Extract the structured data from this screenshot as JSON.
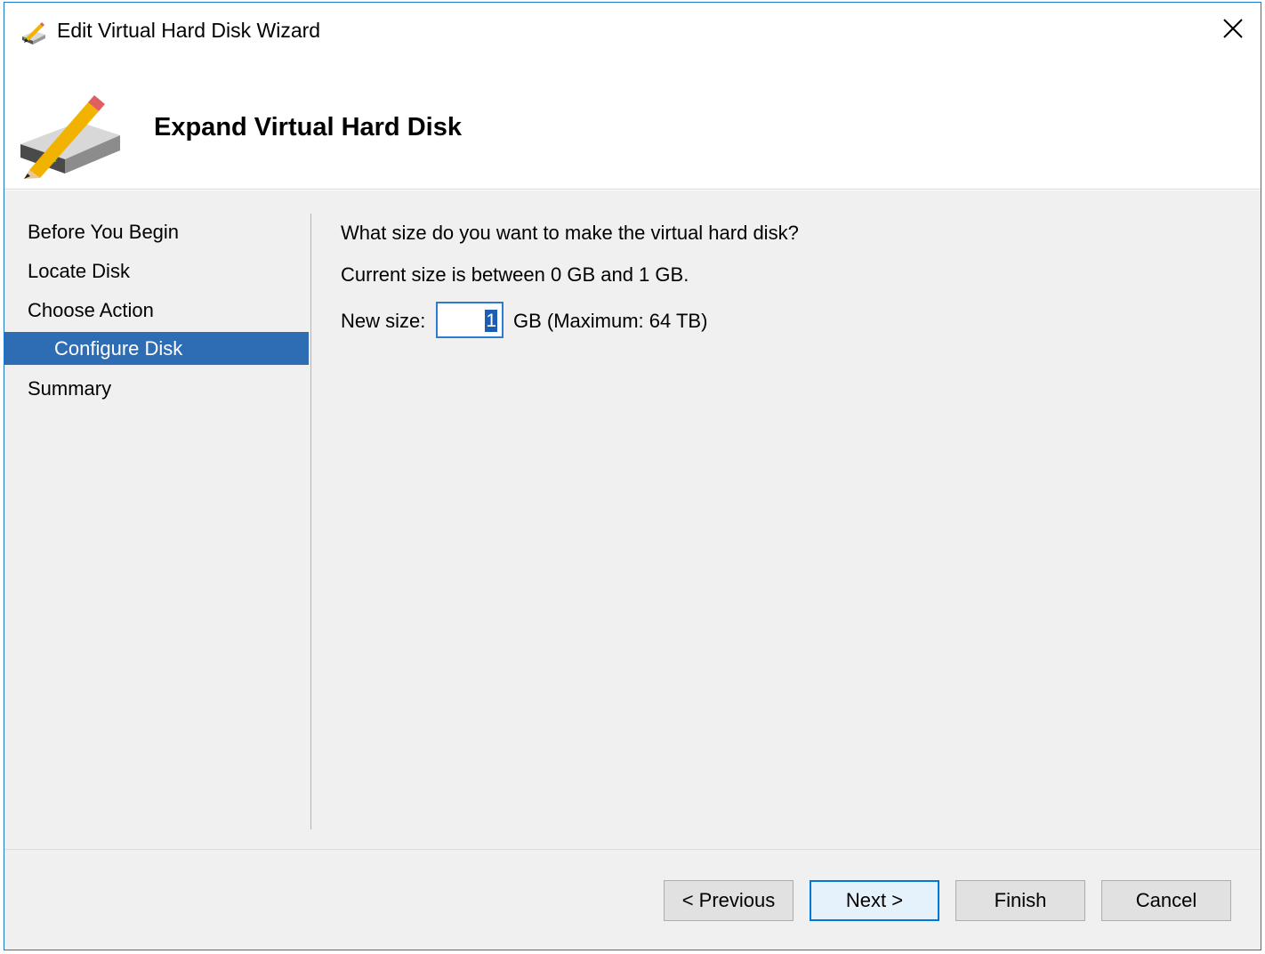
{
  "window": {
    "title": "Edit Virtual Hard Disk Wizard",
    "icon": "pencil-disk-icon",
    "close_icon": "close-icon"
  },
  "header": {
    "title": "Expand Virtual Hard Disk",
    "icon": "pencil-disk-icon"
  },
  "nav": {
    "items": [
      {
        "label": "Before You Begin",
        "active": false
      },
      {
        "label": "Locate Disk",
        "active": false
      },
      {
        "label": "Choose Action",
        "active": false
      },
      {
        "label": "Configure Disk",
        "active": true
      },
      {
        "label": "Summary",
        "active": false
      }
    ]
  },
  "content": {
    "question": "What size do you want to make the virtual hard disk?",
    "current_range": "Current size is between 0 GB and 1 GB.",
    "new_size_label": "New size:",
    "new_size_value": "1",
    "unit_text": "GB (Maximum: 64 TB)"
  },
  "buttons": {
    "previous": "< Previous",
    "next": "Next >",
    "finish": "Finish",
    "cancel": "Cancel"
  },
  "colors": {
    "accent": "#0078d7",
    "selected_nav": "#2e6db4",
    "panel_bg": "#f0f0f0"
  }
}
